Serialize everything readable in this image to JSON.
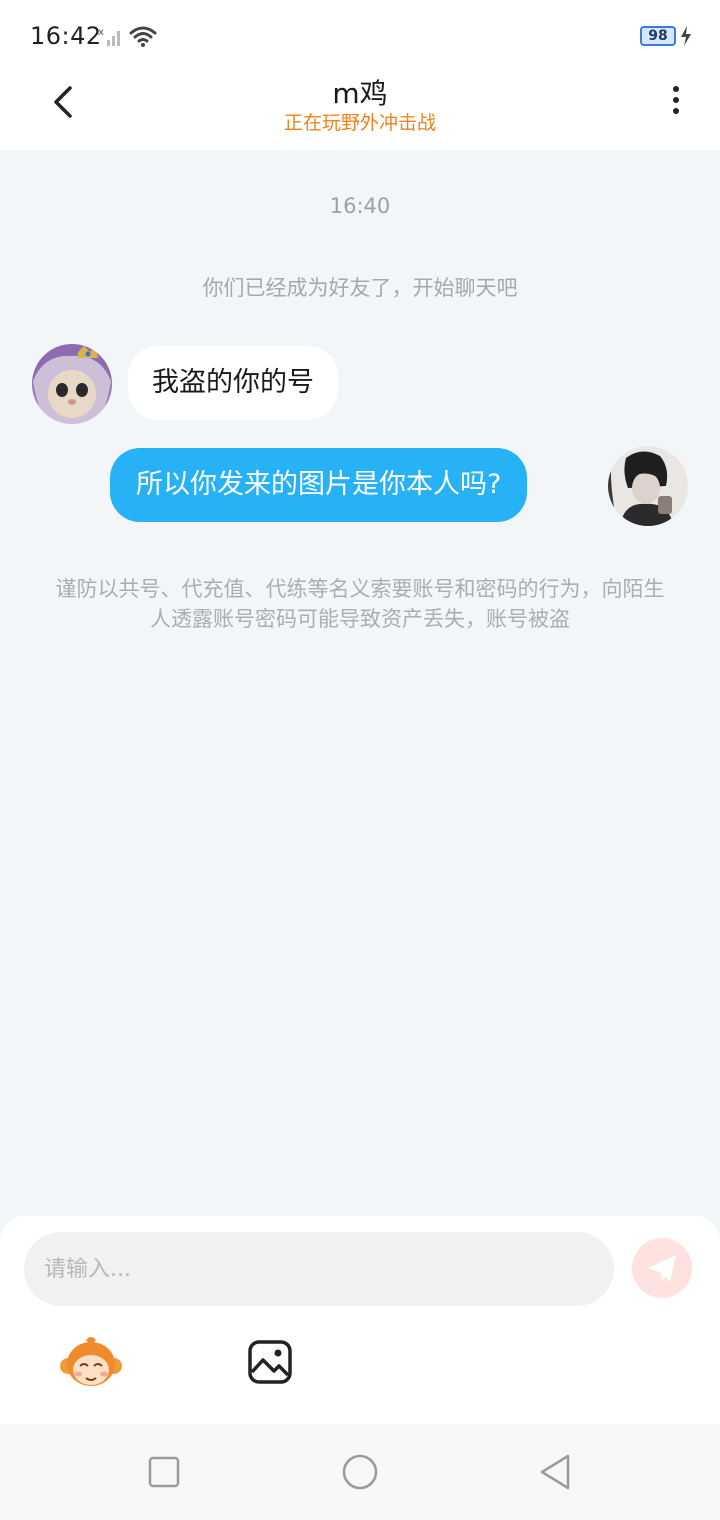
{
  "status_bar": {
    "time": "16:42",
    "battery": "98"
  },
  "header": {
    "title": "m鸡",
    "subtitle": "正在玩野外冲击战"
  },
  "chat": {
    "timestamp": "16:40",
    "system_message": "你们已经成为好友了，开始聊天吧",
    "messages": [
      {
        "side": "left",
        "text": "我盗的你的号"
      },
      {
        "side": "right",
        "text": "所以你发来的图片是你本人吗?"
      }
    ],
    "warning": "谨防以共号、代充值、代练等名义索要账号和密码的行为，向陌生人透露账号密码可能导致资产丢失，账号被盗"
  },
  "input": {
    "placeholder": "请输入..."
  },
  "colors": {
    "accent_orange": "#f0831e",
    "bubble_blue": "#27b1f7",
    "chat_bg": "#f2f6f9"
  },
  "icons": {
    "back": "chevron-left-icon",
    "more": "more-vertical-icon",
    "send": "paper-plane-icon",
    "emoji": "monkey-emoji-icon",
    "image": "image-icon"
  }
}
